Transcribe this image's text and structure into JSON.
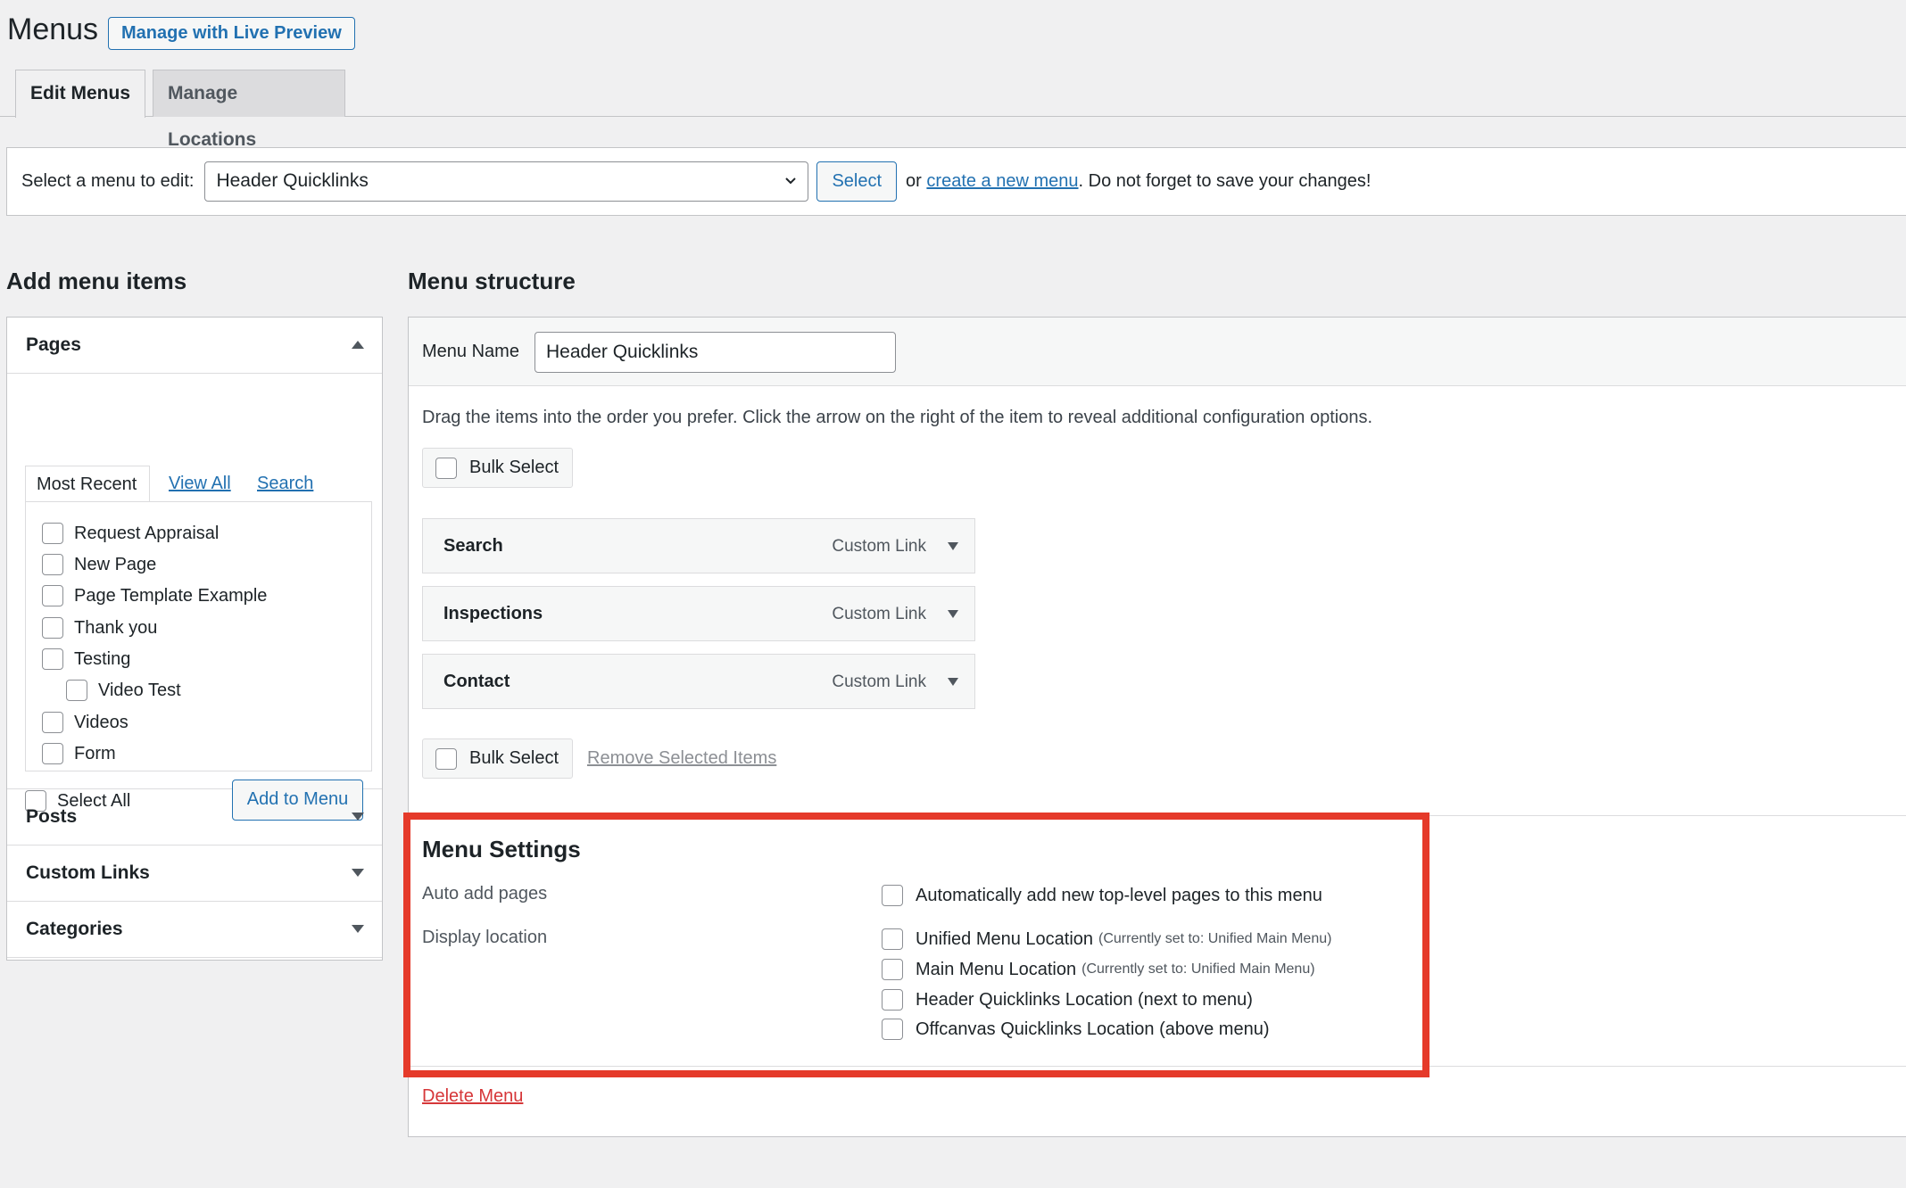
{
  "header": {
    "title": "Menus",
    "live_preview_label": "Manage with Live Preview"
  },
  "tabs": [
    {
      "label": "Edit Menus",
      "active": true
    },
    {
      "label": "Manage Locations",
      "active": false
    }
  ],
  "menu_select": {
    "label": "Select a menu to edit:",
    "selected": "Header Quicklinks",
    "select_button": "Select",
    "or_text": "or",
    "create_link": "create a new menu",
    "trail_text": ". Do not forget to save your changes!"
  },
  "add_items": {
    "heading": "Add menu items",
    "pages": {
      "title": "Pages",
      "tabs": [
        "Most Recent",
        "View All",
        "Search"
      ],
      "items": [
        {
          "label": "Request Appraisal",
          "child": false
        },
        {
          "label": "New Page",
          "child": false
        },
        {
          "label": "Page Template Example",
          "child": false
        },
        {
          "label": "Thank you",
          "child": false
        },
        {
          "label": "Testing",
          "child": false
        },
        {
          "label": "Video Test",
          "child": true
        },
        {
          "label": "Videos",
          "child": false
        },
        {
          "label": "Form",
          "child": false
        }
      ],
      "select_all": "Select All",
      "add_button": "Add to Menu"
    },
    "sections": [
      "Posts",
      "Custom Links",
      "Categories"
    ]
  },
  "structure": {
    "heading": "Menu structure",
    "menu_name_label": "Menu Name",
    "menu_name_value": "Header Quicklinks",
    "instructions": "Drag the items into the order you prefer. Click the arrow on the right of the item to reveal additional configuration options.",
    "bulk_select_label": "Bulk Select",
    "items": [
      {
        "title": "Search",
        "type": "Custom Link"
      },
      {
        "title": "Inspections",
        "type": "Custom Link"
      },
      {
        "title": "Contact",
        "type": "Custom Link"
      }
    ],
    "remove_selected": "Remove Selected Items"
  },
  "settings": {
    "title": "Menu Settings",
    "auto_add_label": "Auto add pages",
    "auto_add_option": "Automatically add new top-level pages to this menu",
    "display_location_label": "Display location",
    "locations": [
      {
        "label": "Unified Menu Location",
        "note": "(Currently set to: Unified Main Menu)"
      },
      {
        "label": "Main Menu Location",
        "note": "(Currently set to: Unified Main Menu)"
      },
      {
        "label": "Header Quicklinks Location (next to menu)",
        "note": ""
      },
      {
        "label": "Offcanvas Quicklinks Location (above menu)",
        "note": ""
      }
    ],
    "delete_menu": "Delete Menu"
  },
  "colors": {
    "accent": "#2271b1",
    "highlight": "#e53a2a",
    "delete": "#d63638"
  }
}
